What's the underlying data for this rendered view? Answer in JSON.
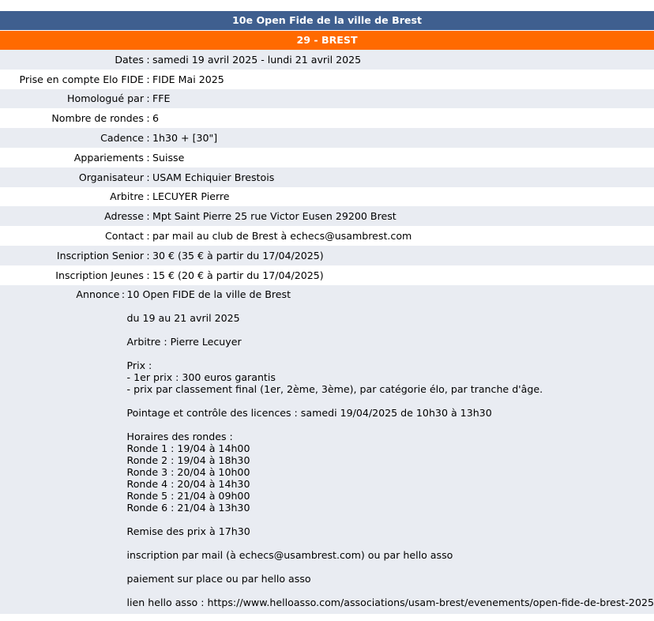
{
  "header": {
    "title": "10e Open Fide de la ville de Brest",
    "region": "29 - BREST"
  },
  "details": [
    {
      "label": "Dates",
      "value": "samedi 19 avril 2025 - lundi 21 avril 2025"
    },
    {
      "label": "Prise en compte Elo FIDE",
      "value": "FIDE Mai 2025"
    },
    {
      "label": "Homologué par",
      "value": "FFE"
    },
    {
      "label": "Nombre de rondes",
      "value": "6"
    },
    {
      "label": "Cadence",
      "value": "1h30 + [30\"]"
    },
    {
      "label": "Appariements",
      "value": "Suisse"
    },
    {
      "label": "Organisateur",
      "value": "USAM Echiquier Brestois"
    },
    {
      "label": "Arbitre",
      "value": "LECUYER Pierre"
    },
    {
      "label": "Adresse",
      "value": "Mpt Saint Pierre 25 rue Victor Eusen 29200 Brest"
    },
    {
      "label": "Contact",
      "value": "par mail au club de Brest à echecs@usambrest.com"
    },
    {
      "label": "Inscription Senior",
      "value": "30 € (35 € à partir du 17/04/2025)"
    },
    {
      "label": "Inscription Jeunes",
      "value": "15 € (20 € à partir du 17/04/2025)"
    }
  ],
  "annonce": {
    "label": "Annonce",
    "colon": ":",
    "blocks": [
      "10 Open FIDE de la ville de Brest",
      "du 19 au 21 avril 2025",
      "Arbitre : Pierre Lecuyer",
      "Prix :\n- 1er prix : 300 euros garantis\n- prix par classement final (1er, 2ème, 3ème), par catégorie élo, par tranche d'âge.",
      "Pointage et contrôle des licences : samedi 19/04/2025 de 10h30 à 13h30",
      "Horaires des rondes :\nRonde 1 : 19/04 à 14h00\nRonde 2 : 19/04 à 18h30\nRonde 3 : 20/04 à 10h00\nRonde 4 : 20/04 à 14h30\nRonde 5 : 21/04 à 09h00\nRonde 6 : 21/04 à 13h30",
      "Remise des prix à 17h30",
      "inscription par mail (à echecs@usambrest.com) ou par hello asso",
      "paiement sur place ou par hello asso",
      "lien hello asso : https://www.helloasso.com/associations/usam-brest/evenements/open-fide-de-brest-2025"
    ]
  },
  "colors": {
    "title_bg": "#3f5f8f",
    "region_bg": "#ff6a00",
    "row_alt_bg": "#e9ecf2"
  }
}
